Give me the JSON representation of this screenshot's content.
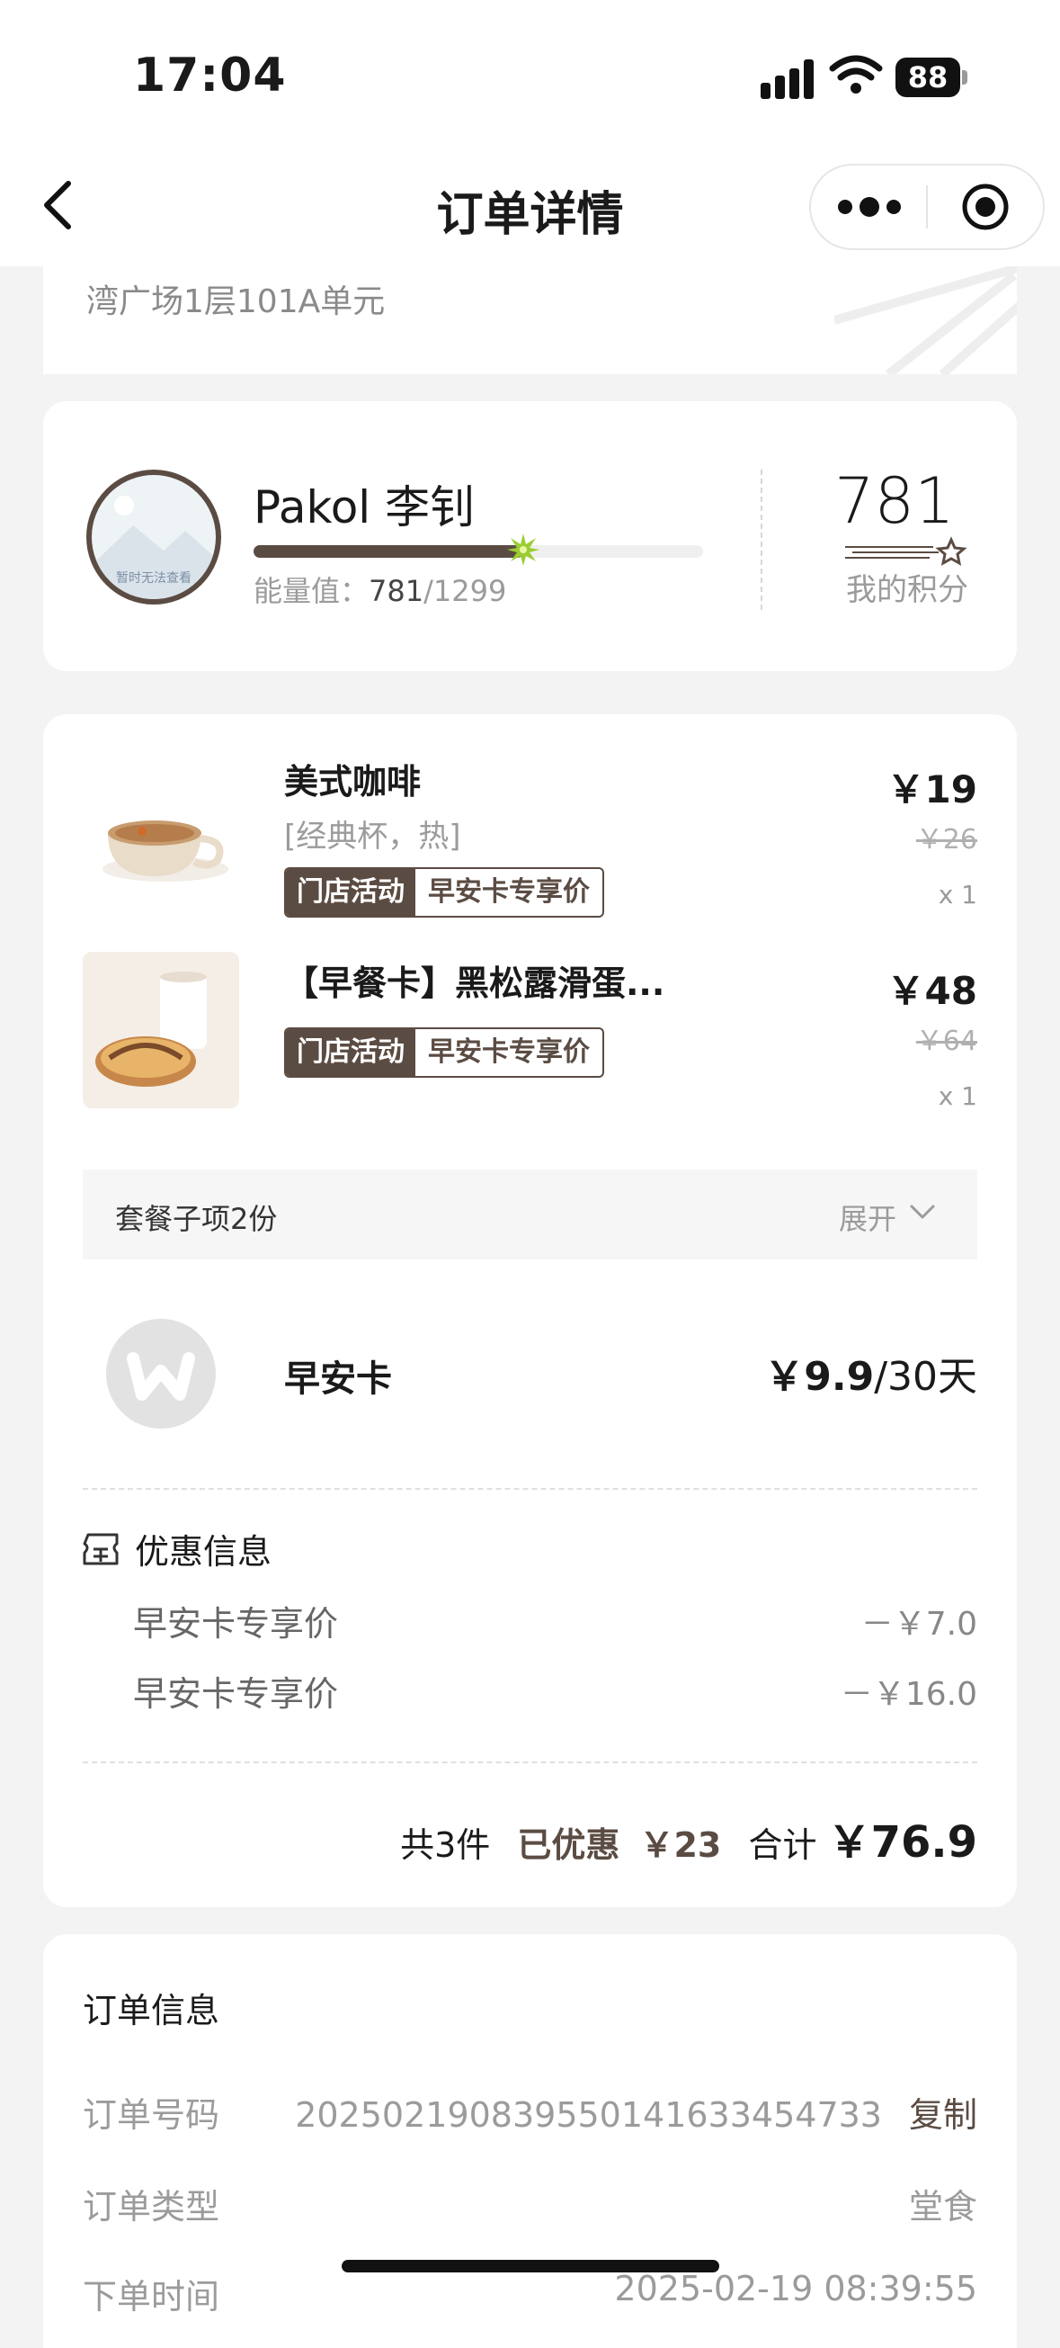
{
  "status_bar": {
    "time": "17:04",
    "battery": "88"
  },
  "nav": {
    "title": "订单详情"
  },
  "address": {
    "text": "湾广场1层101A单元"
  },
  "member": {
    "name": "Pakol 李钊",
    "avatar_text": "暂时无法查看",
    "energy_label": "能量值：",
    "energy_value": "781",
    "energy_max": "/1299",
    "energy_progress": 0.6,
    "points": "781",
    "points_label": "我的积分"
  },
  "items": [
    {
      "name": "美式咖啡",
      "spec": "[经典杯，热]",
      "tag_left": "门店活动",
      "tag_right": "早安卡专享价",
      "price": "￥19",
      "original_price": "￥26",
      "qty": "x 1"
    },
    {
      "name": "【早餐卡】黑松露滑蛋...",
      "tag_left": "门店活动",
      "tag_right": "早安卡专享价",
      "price": "￥48",
      "original_price": "￥64",
      "qty": "x 1"
    }
  ],
  "bundle": {
    "label": "套餐子项2份",
    "expand": "展开"
  },
  "card_item": {
    "name": "早安卡",
    "price": "￥9.9",
    "period": "/30天"
  },
  "discount": {
    "title": "优惠信息",
    "rows": [
      {
        "label": "早安卡专享价",
        "value": "－￥7.0"
      },
      {
        "label": "早安卡专享价",
        "value": "－￥16.0"
      }
    ]
  },
  "summary": {
    "count": "共3件",
    "saved_label": "已优惠",
    "saved_value": "￥23",
    "total_label": "合计",
    "total_value": "￥76.9"
  },
  "order_info": {
    "title": "订单信息",
    "number_label": "订单号码",
    "number_value": "2025021908395501416334547​33",
    "copy": "复制",
    "type_label": "订单类型",
    "type_value": "堂食",
    "time_label": "下单时间",
    "time_value": "2025-02-19 08:39:55"
  },
  "colors": {
    "accent": "#5b4c43",
    "star": "#9acd32"
  }
}
